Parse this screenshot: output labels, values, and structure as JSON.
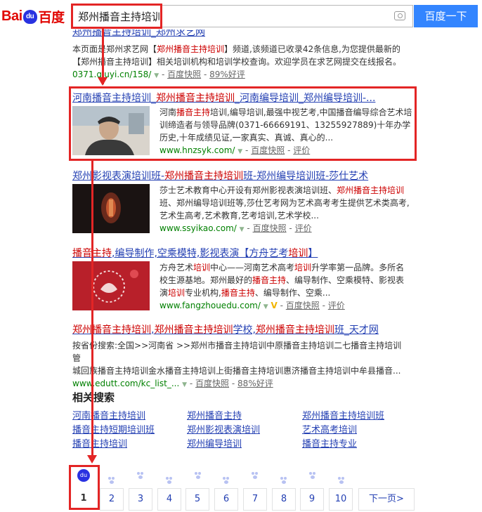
{
  "header": {
    "logo_text": "Bai",
    "logo_paw": "du",
    "logo_cn": "百度",
    "search_value": "郑州播音主持培训",
    "search_button": "百度一下"
  },
  "results": [
    {
      "title": "郑州播音主持培训_郑州求艺网",
      "abstract_1": "本页面是郑州求艺网【",
      "abstract_hl": "郑州播音主持培训",
      "abstract_2": "】频道,该频道已收录42条信息,为您提供最新的",
      "abstract_3": "【郑州播音主持培训】相关培训机构和培训学校查询。欢迎学员在求艺网提交在线报名。",
      "url": "0371.qiuyi.cn/158/",
      "snapshot": "百度快照",
      "rating": "89%好评"
    },
    {
      "title_1": "河南播音主持培训_",
      "title_2": "郑州播音主持培训",
      "title_3": "_河南编导培训_郑州编导培训-...",
      "abstract_a": "河南",
      "abstract_hl": "播音主持",
      "abstract_b": "培训,编导培训,最强中视艺考,中国播音编导综合艺术培训缔造者与领导品牌(0371-66669191、13255927889)十年办学历史,十年成绩见证,一家真实、真诚、真心的...",
      "url": "www.hnzsyk.com/",
      "snapshot": "百度快照",
      "rating": "评价"
    },
    {
      "title_1": "郑州影视表演培训班-",
      "title_2": "郑州播音主持培训",
      "title_3": "班-郑州编导培训班-莎仕艺术",
      "abstract_a": "莎士艺术教育中心开设有郑州影视表演培训班、",
      "abstract_hl": "郑州播音主持培训",
      "abstract_b": "班、郑州编导培训班等,莎仕艺考网为艺术高考考生提供艺术类高考,艺术生高考,艺术教育,艺考培训,艺术学校...",
      "url": "www.ssyikao.com/",
      "snapshot": "百度快照",
      "rating": "评价"
    },
    {
      "title_1": "播音主持",
      "title_2": ",编导制作,空乘模特,影视表演【方舟艺考",
      "title_3": "培训",
      "title_4": "】",
      "abstract_a": "方舟艺术",
      "abstract_hl1": "培训",
      "abstract_b": "中心——河南艺术高考",
      "abstract_hl2": "培训",
      "abstract_c": "升学率第一品牌。多所名校生源基地。郑州最好的",
      "abstract_hl3": "播音主持",
      "abstract_d": "、编导制作、空乘模特、影视表演",
      "abstract_hl4": "培训",
      "abstract_e": "专业机构,",
      "abstract_hl5": "播音主持",
      "abstract_f": "、编导制作、空乘...",
      "url": "www.fangzhouedu.com/",
      "v_badge": "V",
      "snapshot": "百度快照",
      "rating": "评价"
    },
    {
      "title_1": "郑州播音主持培训",
      "title_2": ",",
      "title_3": "郑州播音主持培训",
      "title_4": "学校,",
      "title_5": "郑州播音主持培训",
      "title_6": "班_天才网",
      "abstract_line1": "按省份搜索:全国>>河南省 >>郑州市播音主持培训中原播音主持培训二七播音主持培训管",
      "abstract_line2": "城回族播音主持培训金水播音主持培训上街播音主持培训惠济播音主持培训中牟县播音...",
      "url": "www.edutt.com/kc_list_...",
      "snapshot": "百度快照",
      "rating": "88%好评"
    }
  ],
  "related": {
    "title": "相关搜索",
    "items": [
      "河南播音主持培训",
      "郑州播音主持",
      "郑州播音主持培训班",
      "播音主持短期培训班",
      "郑州影视表演培训",
      "艺术高考培训",
      "播音主持培训",
      "郑州编导培训",
      "播音主持专业"
    ]
  },
  "pager": {
    "pages": [
      "1",
      "2",
      "3",
      "4",
      "5",
      "6",
      "7",
      "8",
      "9",
      "10"
    ],
    "next": "下一页>",
    "current": "1"
  },
  "colors": {
    "annotation": "#e32525",
    "link": "#2440b3",
    "highlight": "#cc0000",
    "url": "#008000",
    "button": "#3385ff"
  }
}
